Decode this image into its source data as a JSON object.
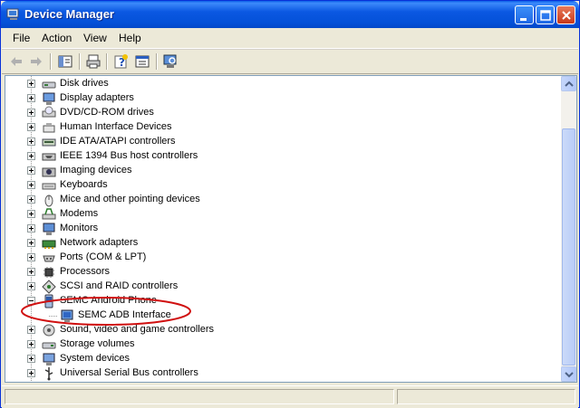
{
  "window": {
    "title": "Device Manager"
  },
  "menu": {
    "items": [
      "File",
      "Action",
      "View",
      "Help"
    ]
  },
  "toolbar": {
    "icons": [
      "back-icon",
      "forward-icon",
      "show-hide-tree-icon",
      "print-icon",
      "help-icon",
      "properties-icon",
      "scan-hardware-icon"
    ]
  },
  "tree": {
    "items": [
      {
        "label": "Disk drives",
        "icon": "disk-drive-icon"
      },
      {
        "label": "Display adapters",
        "icon": "display-adapter-icon"
      },
      {
        "label": "DVD/CD-ROM drives",
        "icon": "cdrom-icon"
      },
      {
        "label": "Human Interface Devices",
        "icon": "hid-icon"
      },
      {
        "label": "IDE ATA/ATAPI controllers",
        "icon": "ide-controller-icon"
      },
      {
        "label": "IEEE 1394 Bus host controllers",
        "icon": "ieee1394-icon"
      },
      {
        "label": "Imaging devices",
        "icon": "camera-icon"
      },
      {
        "label": "Keyboards",
        "icon": "keyboard-icon"
      },
      {
        "label": "Mice and other pointing devices",
        "icon": "mouse-icon"
      },
      {
        "label": "Modems",
        "icon": "modem-icon"
      },
      {
        "label": "Monitors",
        "icon": "monitor-icon"
      },
      {
        "label": "Network adapters",
        "icon": "network-adapter-icon"
      },
      {
        "label": "Ports (COM & LPT)",
        "icon": "port-icon"
      },
      {
        "label": "Processors",
        "icon": "processor-icon"
      },
      {
        "label": "SCSI and RAID controllers",
        "icon": "scsi-icon"
      },
      {
        "label": "SEMC Android Phone",
        "icon": "phone-icon",
        "expanded": true
      },
      {
        "label": "SEMC ADB Interface",
        "icon": "adb-interface-icon",
        "child": true
      },
      {
        "label": "Sound, video and game controllers",
        "icon": "sound-icon"
      },
      {
        "label": "Storage volumes",
        "icon": "storage-volume-icon"
      },
      {
        "label": "System devices",
        "icon": "system-device-icon"
      },
      {
        "label": "Universal Serial Bus controllers",
        "icon": "usb-icon"
      }
    ]
  },
  "colors": {
    "titlebar": "#0451d8",
    "annotation": "#d01010"
  }
}
